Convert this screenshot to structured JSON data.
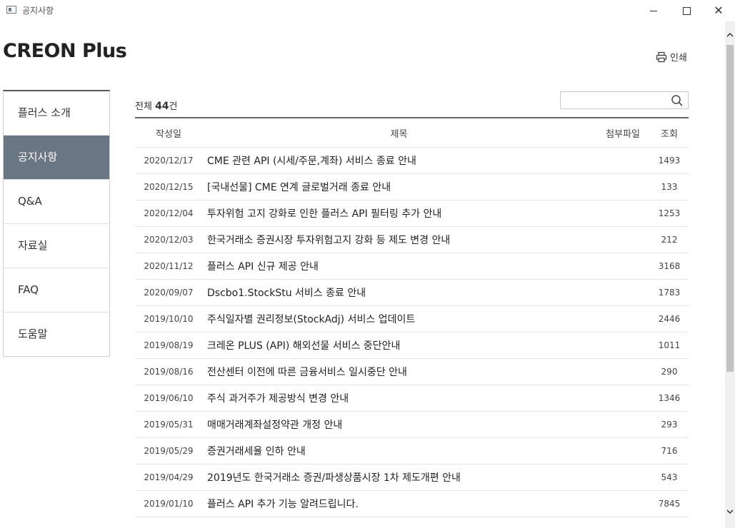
{
  "window": {
    "title": "공지사항",
    "minimize_label": "",
    "maximize_label": "",
    "close_label": "✕"
  },
  "brand": "CREON Plus",
  "print_label": "인쇄",
  "sidebar": {
    "items": [
      {
        "label": "플러스 소개",
        "active": false
      },
      {
        "label": "공지사항",
        "active": true
      },
      {
        "label": "Q&A",
        "active": false
      },
      {
        "label": "자료실",
        "active": false
      },
      {
        "label": "FAQ",
        "active": false
      },
      {
        "label": "도움말",
        "active": false
      }
    ]
  },
  "list": {
    "count_prefix": "전체",
    "count": "44",
    "count_suffix": "건",
    "search_placeholder": "",
    "headers": {
      "date": "작성일",
      "title": "제목",
      "attach": "첨부파일",
      "views": "조회"
    },
    "rows": [
      {
        "date": "2020/12/17",
        "title": "CME 관련 API (시세/주문,계좌) 서비스 종료 안내",
        "views": "1493"
      },
      {
        "date": "2020/12/15",
        "title": "[국내선물] CME 연계 글로벌거래 종료 안내",
        "views": "133"
      },
      {
        "date": "2020/12/04",
        "title": "투자위험 고지 강화로 인한 플러스 API 필터링 추가 안내",
        "views": "1253"
      },
      {
        "date": "2020/12/03",
        "title": "한국거래소 증권시장 투자위험고지 강화 등 제도 변경 안내",
        "views": "212"
      },
      {
        "date": "2020/11/12",
        "title": "플러스 API 신규 제공 안내",
        "views": "3168"
      },
      {
        "date": "2020/09/07",
        "title": "Dscbo1.StockStu 서비스 종료 안내",
        "views": "1783"
      },
      {
        "date": "2019/10/10",
        "title": "주식일자별 권리정보(StockAdj) 서비스 업데이트",
        "views": "2446"
      },
      {
        "date": "2019/08/19",
        "title": "크레온 PLUS (API) 해외선물 서비스 중단안내",
        "views": "1011"
      },
      {
        "date": "2019/08/16",
        "title": "전산센터 이전에 따른 금융서비스 일시중단 안내",
        "views": "290"
      },
      {
        "date": "2019/06/10",
        "title": "주식 과거주가 제공방식 변경 안내",
        "views": "1346"
      },
      {
        "date": "2019/05/31",
        "title": "매매거래계좌설정약관 개정 안내",
        "views": "293"
      },
      {
        "date": "2019/05/29",
        "title": "증권거래세율 인하 안내",
        "views": "716"
      },
      {
        "date": "2019/04/29",
        "title": "2019년도 한국거래소 증권/파생상품시장 1차 제도개편 안내",
        "views": "543"
      },
      {
        "date": "2019/01/10",
        "title": "플러스 API 추가 기능 알려드립니다.",
        "views": "7845"
      }
    ]
  }
}
